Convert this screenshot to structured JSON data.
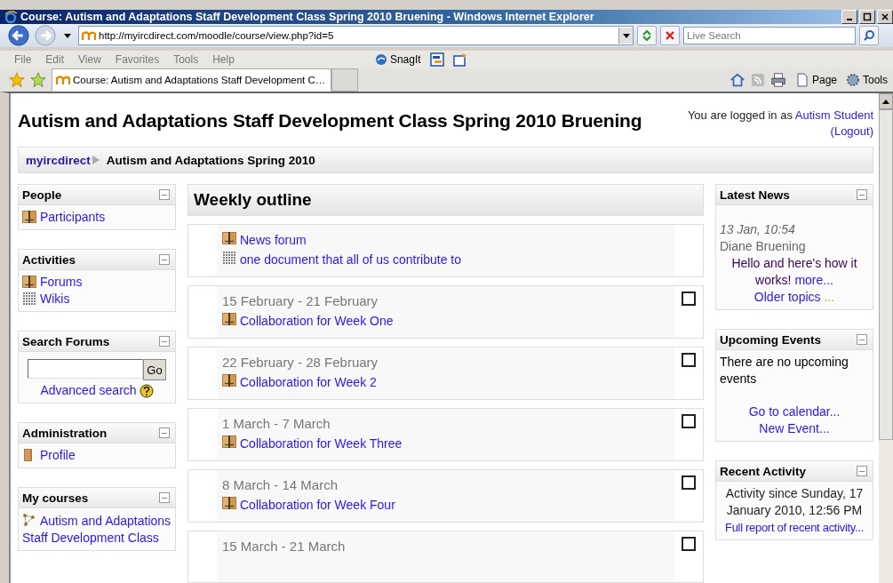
{
  "window": {
    "title": "Course: Autism and Adaptations Staff Development Class Spring 2010 Bruening - Windows Internet Explorer"
  },
  "address_bar": {
    "url": "http://myircdirect.com/moodle/course/view.php?id=5",
    "search_placeholder": "Live Search"
  },
  "menu": [
    "File",
    "Edit",
    "View",
    "Favorites",
    "Tools",
    "Help"
  ],
  "snagit": "SnagIt",
  "tab": {
    "label": "Course: Autism and Adaptations Staff Development C…",
    "selected": true
  },
  "command_bar": [
    "Page",
    "Tools"
  ],
  "page": {
    "heading": "Autism and Adaptations Staff Development Class Spring 2010 Bruening",
    "login": {
      "prefix": "You are logged in as",
      "user": "Autism Student",
      "logout": "(Logout)"
    },
    "breadcrumb": {
      "home": "myircdirect",
      "current": "Autism and Adaptations Spring 2010"
    }
  },
  "left_blocks": [
    {
      "title": "People",
      "kind": "links",
      "items": [
        {
          "kind": "forum",
          "label": "Participants"
        }
      ]
    },
    {
      "title": "Activities",
      "kind": "links",
      "items": [
        {
          "kind": "forum",
          "label": "Forums"
        },
        {
          "kind": "wiki",
          "label": "Wikis"
        }
      ]
    },
    {
      "title": "Search Forums",
      "kind": "search",
      "button": "Go",
      "link": "Advanced search"
    },
    {
      "title": "Administration",
      "kind": "links",
      "items": [
        {
          "kind": "profile",
          "label": "Profile"
        }
      ]
    },
    {
      "title": "My courses",
      "kind": "links",
      "items": [
        {
          "kind": "course",
          "label": "Autism and Adaptations Staff Development Class"
        }
      ]
    }
  ],
  "outline": {
    "title": "Weekly outline",
    "sections": [
      {
        "items": [
          {
            "kind": "forum",
            "label": "News forum"
          },
          {
            "kind": "wiki",
            "label": "one document that all of us contribute to"
          }
        ]
      },
      {
        "date": "15 February - 21 February",
        "checked": false,
        "items": [
          {
            "kind": "forum",
            "label": "Collaboration for Week One"
          }
        ]
      },
      {
        "date": "22 February - 28 February",
        "checked": false,
        "items": [
          {
            "kind": "forum",
            "label": "Collaboration for Week 2"
          }
        ]
      },
      {
        "date": "1 March - 7 March",
        "checked": false,
        "items": [
          {
            "kind": "forum",
            "label": "Collaboration for Week Three"
          }
        ]
      },
      {
        "date": "8 March - 14 March",
        "checked": false,
        "items": [
          {
            "kind": "forum",
            "label": "Collaboration for Week Four"
          }
        ]
      },
      {
        "date": "15 March - 21 March",
        "checked": false
      }
    ]
  },
  "right_blocks": [
    {
      "title": "Latest News",
      "kind": "news",
      "time": "13 Jan, 10:54",
      "author": "Diane Bruening",
      "text": "Hello and here's how it works!",
      "more": "more...",
      "older": "Older topics",
      "older_dots": "..."
    },
    {
      "title": "Upcoming Events",
      "kind": "events",
      "text": "There are no upcoming events",
      "links": [
        "Go to calendar...",
        "New Event..."
      ]
    },
    {
      "title": "Recent Activity",
      "kind": "activity",
      "text": "Activity since Sunday, 17 January 2010, 12:56 PM",
      "link": "Full report of recent activity..."
    }
  ]
}
